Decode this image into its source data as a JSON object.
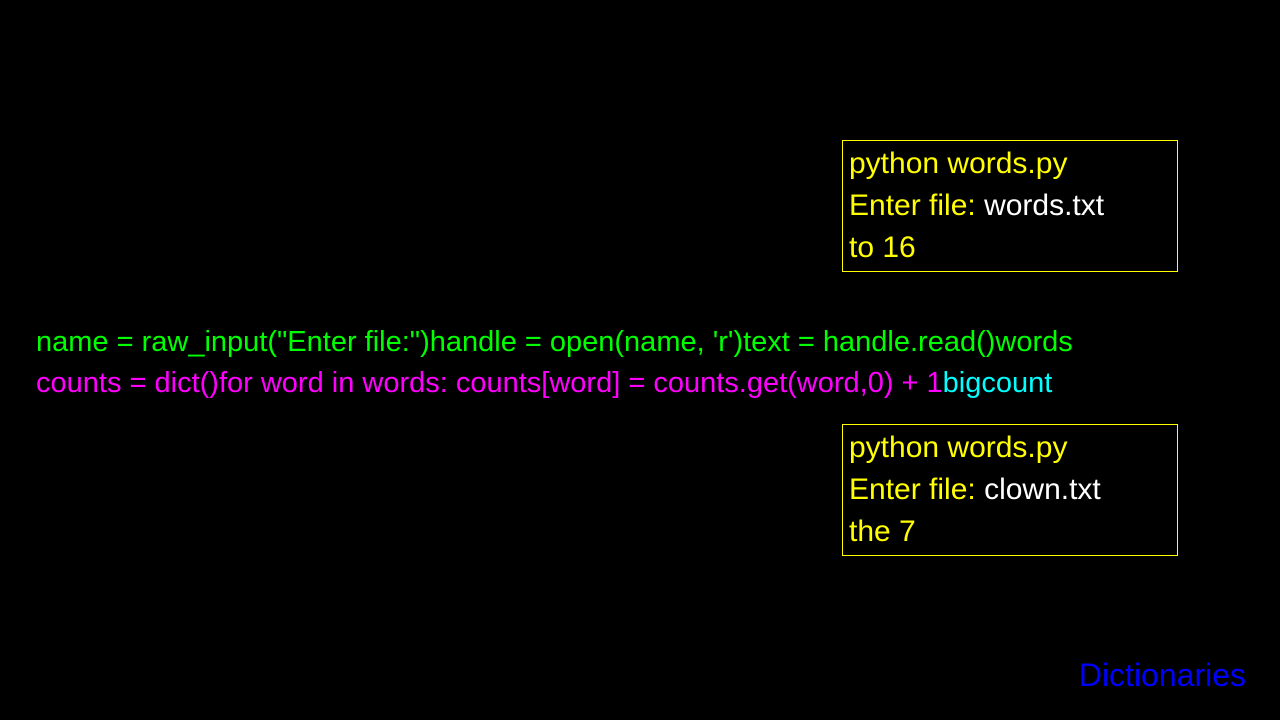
{
  "terminal1": {
    "line1": "python words.py",
    "line2_prompt": "Enter file: ",
    "line2_input": "words.txt",
    "line3": "to 16"
  },
  "terminal2": {
    "line1": "python words.py",
    "line2_prompt": "Enter file: ",
    "line2_input": "clown.txt",
    "line3": "the 7"
  },
  "code": {
    "seg1_green": "name = raw_input(\"Enter file:\")",
    "seg2_green": "handle = open(name, 'r')",
    "seg3_green": "text = handle.read()",
    "seg4_green": "words",
    "seg5_magenta": "counts = dict()",
    "seg6_magenta": "for word in words:    counts[word] = counts.get(word,0) + 1",
    "seg7_cyan": "bigcount"
  },
  "footer": "Dictionaries"
}
